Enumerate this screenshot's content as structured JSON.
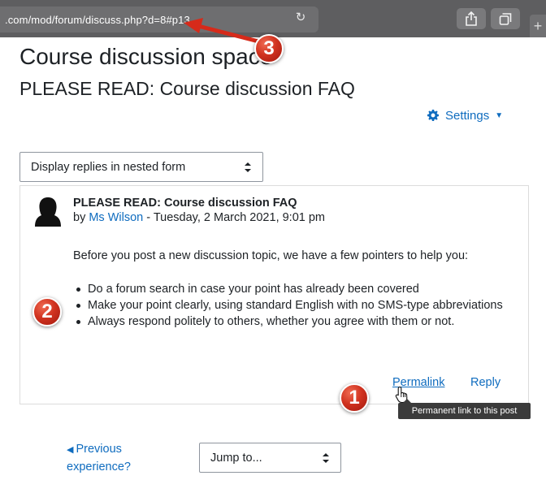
{
  "browser": {
    "url": ".com/mod/forum/discuss.php?d=8#p13",
    "reload_icon": "reload-icon",
    "share_icon": "share-icon",
    "tabs_icon": "tabs-icon",
    "new_tab_label": "+"
  },
  "page": {
    "course_title": "Course discussion space",
    "discussion_title": "PLEASE READ: Course discussion FAQ"
  },
  "settings": {
    "label": "Settings",
    "icon": "gear-icon"
  },
  "display_mode": {
    "selected": "Display replies in nested form"
  },
  "post": {
    "subject": "PLEASE READ: Course discussion FAQ",
    "by_prefix": "by ",
    "author": "Ms Wilson",
    "date": " - Tuesday, 2 March 2021, 9:01 pm",
    "intro": "Before you post a new discussion topic, we have a few pointers to help you:",
    "bullets": [
      "Do a forum search in case your point has already been covered",
      "Make your point clearly, using standard English with no SMS-type abbreviations",
      "Always respond politely to others, whether you agree with them or not."
    ],
    "permalink_label": "Permalink",
    "reply_label": "Reply",
    "tooltip": "Permanent link to this post"
  },
  "navigation": {
    "prev_label": "Previous experience?",
    "prev_arrow": "◀",
    "jump_selected": "Jump to..."
  },
  "annotations": {
    "badge_1": "1",
    "badge_2": "2",
    "badge_3": "3",
    "badge_color": "#d13320"
  },
  "colors": {
    "link": "#0f6cbf",
    "text": "#1d2125",
    "browser_bar": "#5e5e60"
  }
}
